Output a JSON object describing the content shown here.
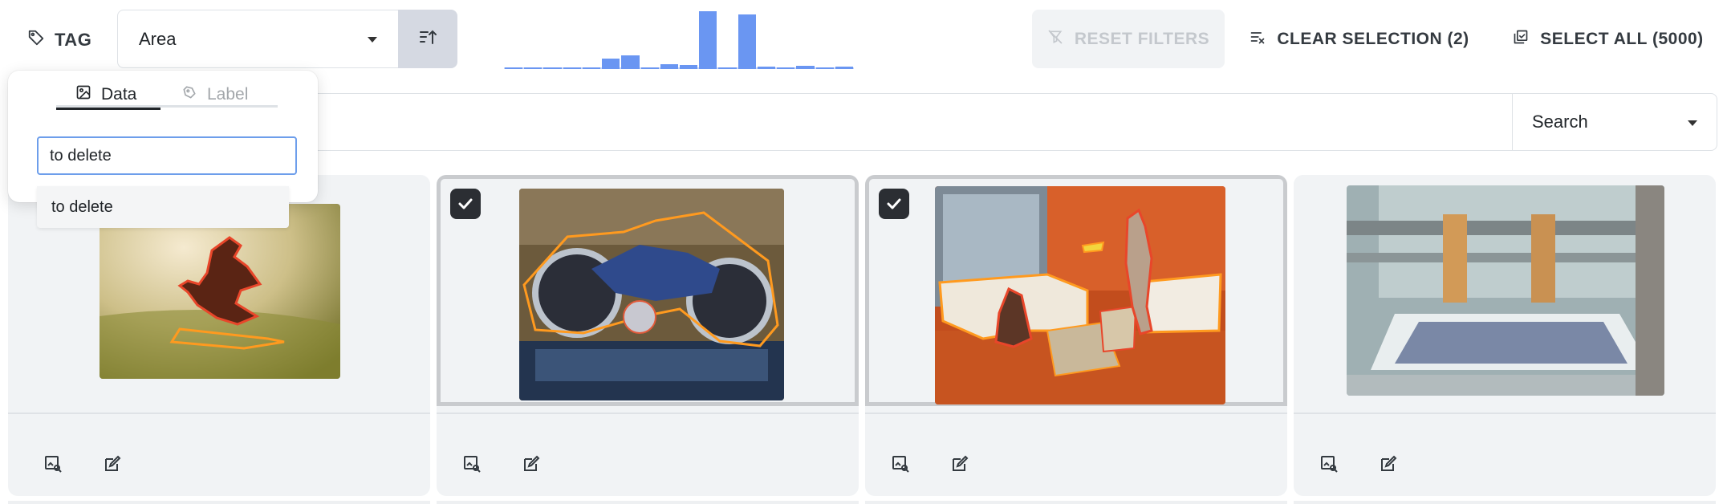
{
  "toolbar": {
    "tag_label": "TAG",
    "sort_value": "Area",
    "reset_label": "RESET FILTERS",
    "clear_label": "CLEAR SELECTION (2)",
    "select_all_label": "SELECT ALL (5000)"
  },
  "histogram": {
    "accent": "#6a96f2",
    "relative_counts": [
      0.01,
      0.01,
      0.01,
      0.02,
      0.02,
      0.18,
      0.23,
      0.02,
      0.08,
      0.07,
      1.0,
      0.02,
      0.94,
      0.04,
      0.02,
      0.06,
      0.02,
      0.04
    ]
  },
  "search": {
    "query": "",
    "mode": "Search"
  },
  "tag_popover": {
    "tabs": [
      {
        "label": "Data",
        "active": true
      },
      {
        "label": "Label",
        "active": false
      }
    ],
    "input_value": "to delete",
    "suggestion": "to delete"
  },
  "cards": [
    {
      "subject": "surfer",
      "selected": false
    },
    {
      "subject": "motorcycle",
      "selected": true
    },
    {
      "subject": "living room with people",
      "selected": true
    },
    {
      "subject": "bathtub under construction",
      "selected": false
    }
  ],
  "colors": {
    "annotation_outline": "#ff9a1f",
    "annotation_outline_alt": "#e8462a",
    "checkbox_bg": "#2b2e33",
    "card_bg": "#f1f3f5"
  }
}
